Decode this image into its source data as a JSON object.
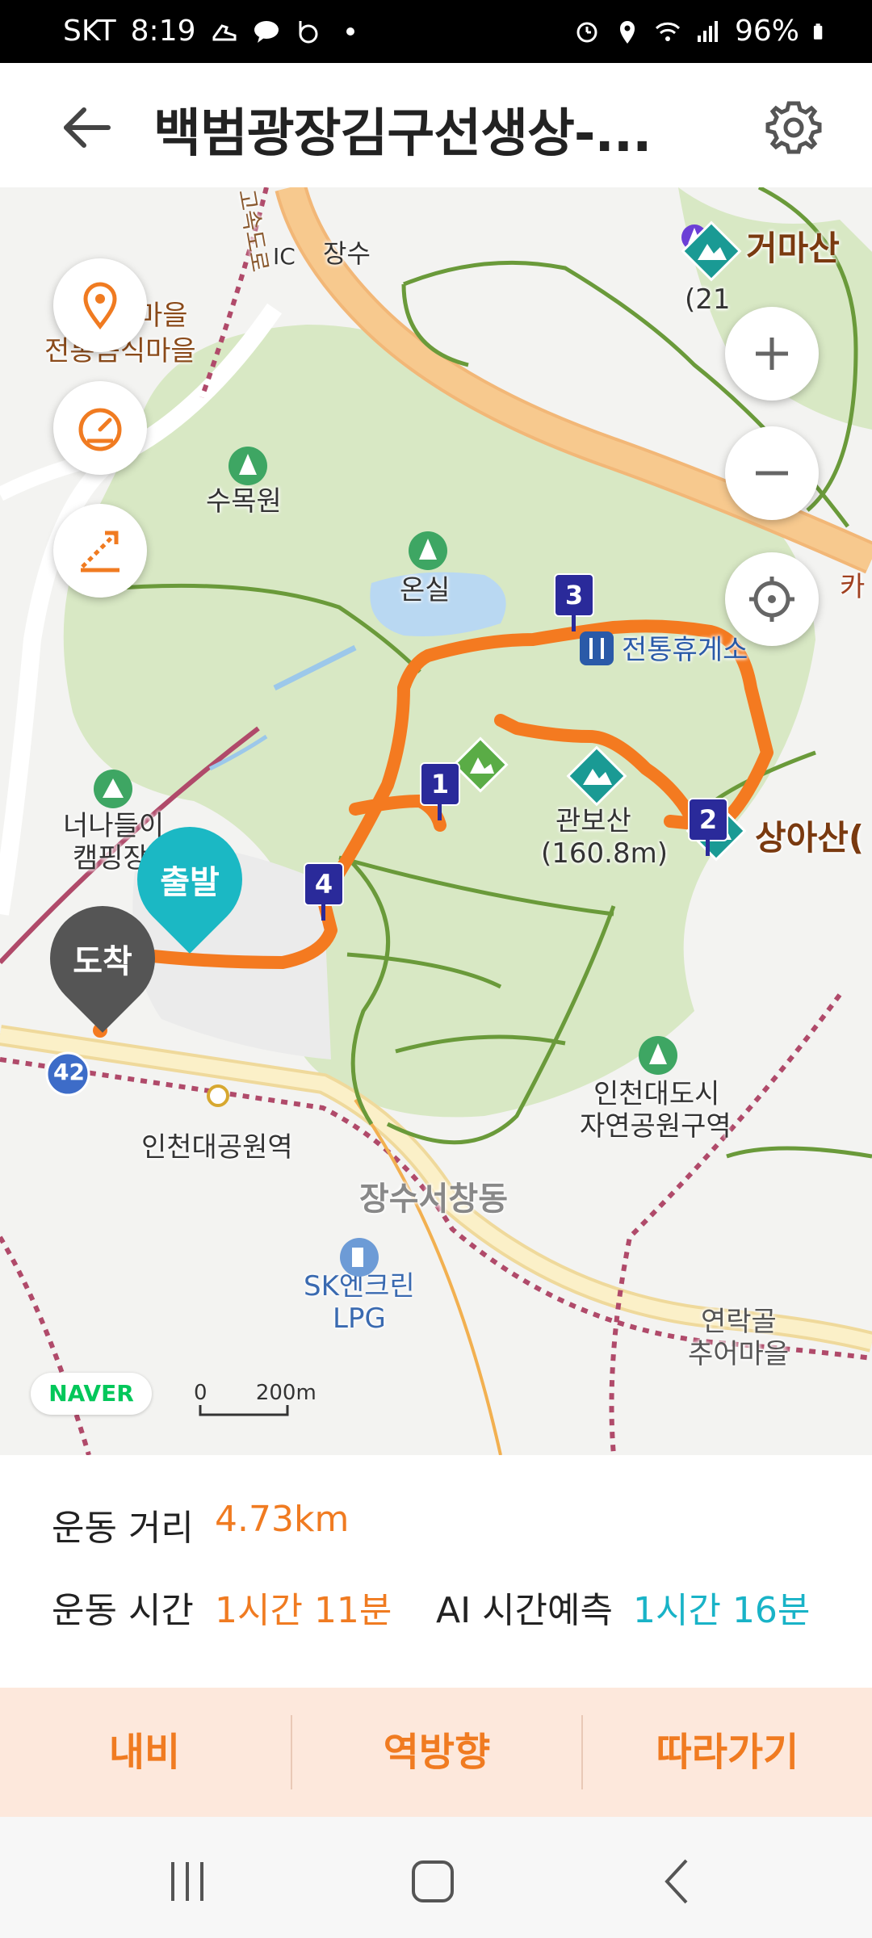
{
  "status_bar": {
    "carrier": "SKT",
    "time": "8:19",
    "battery": "96%",
    "icons": [
      "shoe-icon",
      "talk-icon",
      "b-icon",
      "dot-icon",
      "alarm-icon",
      "location-icon",
      "wifi-icon",
      "signal-icon",
      "battery-icon"
    ]
  },
  "header": {
    "back_icon": "arrow-left-icon",
    "title": "백범광장김구선생상-...",
    "settings_icon": "gear-icon"
  },
  "map": {
    "labels": {
      "jangsu": "장수",
      "ic": "IC",
      "highway": "고속도로",
      "village_top": "마을",
      "food_village": "전통음식마을",
      "arboretum": "수목원",
      "greenhouse": "온실",
      "rest_area": "전통휴게소",
      "gwanbosan": "관보산",
      "gwanbosan_height": "(160.8m)",
      "sangasan": "상아산(",
      "geomasan": "거마산",
      "geomasan_height": "(21",
      "camping": "너나들이",
      "camping2": "캠핑장",
      "park": "인천대도시",
      "park2": "자연공원구역",
      "station": "인천대공원역",
      "district": "장수서창동",
      "gas": "SK엔크린",
      "gas2": "LPG",
      "yeonrakgol": "연락골",
      "yeonrakgol2": "추어마을",
      "road_42": "42",
      "cafe_edge": "카",
      "start_marker": "출발",
      "end_marker": "도착"
    },
    "waypoints": [
      "1",
      "2",
      "3",
      "4"
    ],
    "buttons": {
      "location_pin": "location-pin-icon",
      "speed": "speedometer-icon",
      "elevation": "elevation-icon",
      "zoom_in": "plus-icon",
      "zoom_out": "minus-icon",
      "recenter": "crosshair-icon"
    },
    "attribution": "NAVER",
    "scale": {
      "zero": "0",
      "distance": "200m"
    },
    "colors": {
      "route": "#f47a20",
      "park": "#d8e8c4",
      "trail": "#6a9a3a",
      "highway": "#f7c98e"
    }
  },
  "stats": {
    "distance_label": "운동 거리",
    "distance_value": "4.73km",
    "time_label": "운동 시간",
    "time_value": "1시간 11분",
    "ai_label": "AI 시간예측",
    "ai_value": "1시간 16분"
  },
  "actions": {
    "navigate": "내비",
    "reverse": "역방향",
    "follow": "따라가기"
  },
  "nav_bar": {
    "recent_icon": "recent-apps-icon",
    "home_icon": "home-icon",
    "back_icon": "back-icon"
  }
}
